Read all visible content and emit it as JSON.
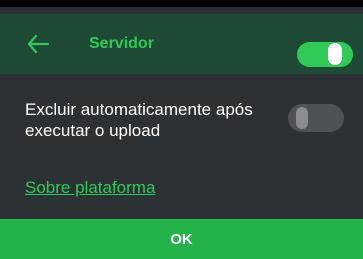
{
  "header": {
    "back_icon": "arrow-left-icon",
    "title": "Servidor",
    "master_toggle": {
      "state": "on",
      "color": "#2fcb56"
    }
  },
  "settings": {
    "auto_delete": {
      "label": "Excluir automaticamente após executar o upload",
      "toggle": {
        "state": "off"
      }
    }
  },
  "link": {
    "label": "Sobre plataforma"
  },
  "footer": {
    "ok_label": "OK"
  },
  "colors": {
    "accent": "#2fcb56",
    "header_bg": "#1f4a35",
    "body_bg": "#2c3135",
    "button_bg": "#24b24a"
  }
}
